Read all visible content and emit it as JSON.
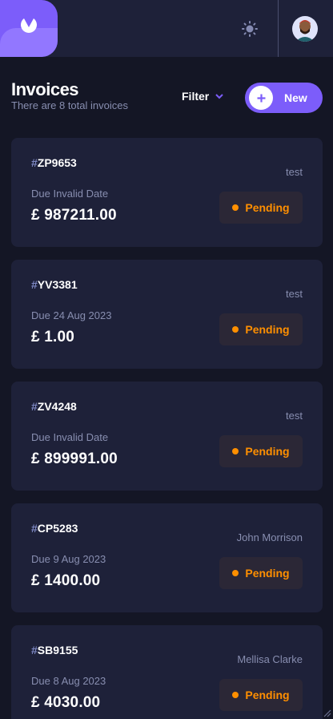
{
  "header": {
    "logo_icon": "logo-icon",
    "theme_icon": "sun-icon",
    "avatar": "user-avatar"
  },
  "page": {
    "title": "Invoices",
    "subtitle": "There are 8 total invoices",
    "filter_label": "Filter",
    "new_label": "New"
  },
  "colors": {
    "accent": "#7c5dfa",
    "background": "#141625",
    "card": "#1e2139",
    "pending": "#ff8f00",
    "muted": "#888eb0"
  },
  "invoices": [
    {
      "hash": "#",
      "id": "ZP9653",
      "client": "test",
      "due": "Due Invalid Date",
      "amount": "£ 987211.00",
      "status": "Pending"
    },
    {
      "hash": "#",
      "id": "YV3381",
      "client": "test",
      "due": "Due 24 Aug 2023",
      "amount": "£ 1.00",
      "status": "Pending"
    },
    {
      "hash": "#",
      "id": "ZV4248",
      "client": "test",
      "due": "Due Invalid Date",
      "amount": "£ 899991.00",
      "status": "Pending"
    },
    {
      "hash": "#",
      "id": "CP5283",
      "client": "John Morrison",
      "due": "Due 9 Aug 2023",
      "amount": "£ 1400.00",
      "status": "Pending"
    },
    {
      "hash": "#",
      "id": "SB9155",
      "client": "Mellisa Clarke",
      "due": "Due 8 Aug 2023",
      "amount": "£ 4030.00",
      "status": "Pending"
    }
  ]
}
